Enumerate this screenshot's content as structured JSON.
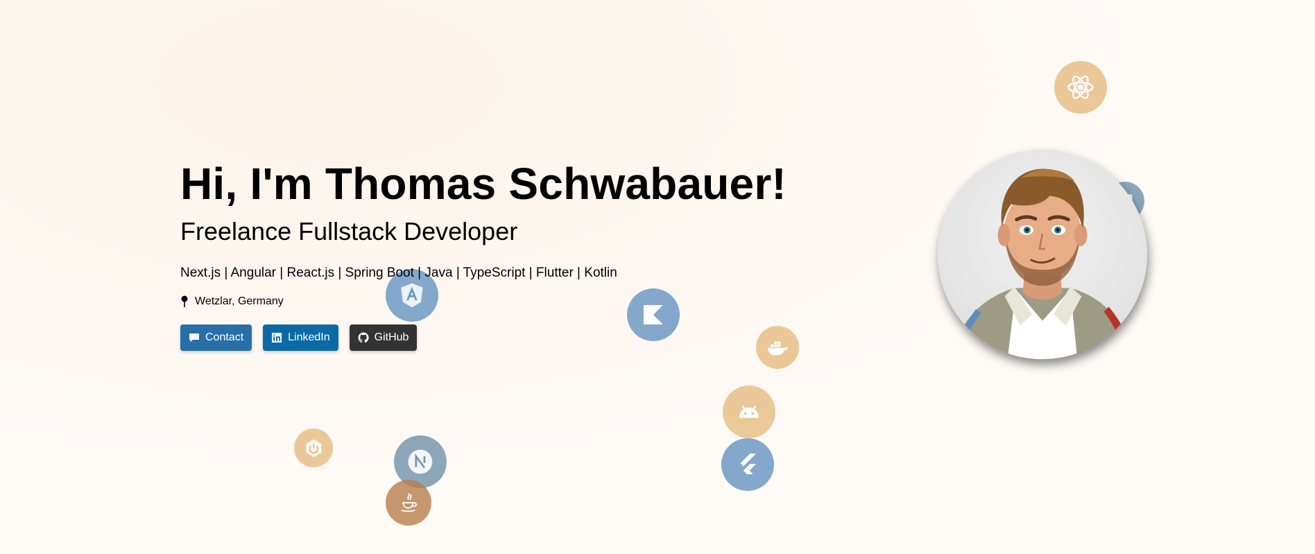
{
  "hero": {
    "title": "Hi, I'm Thomas Schwabauer!",
    "subtitle": "Freelance Fullstack Developer",
    "stack": "Next.js | Angular | React.js | Spring Boot | Java | TypeScript | Flutter | Kotlin",
    "location": "Wetzlar, Germany",
    "location_icon": "pin-icon"
  },
  "buttons": {
    "contact": "Contact",
    "linkedin": "LinkedIn",
    "github": "GitHub"
  },
  "tech_icons": [
    "react-icon",
    "angular-icon",
    "kotlin-icon",
    "docker-icon",
    "android-icon",
    "flutter-icon",
    "spring-icon",
    "nextjs-icon",
    "java-icon",
    "typescript-icon"
  ],
  "colors": {
    "contact": "#266fa8",
    "linkedin": "#0b6aa6",
    "github": "#333333",
    "bubble_blue": "#6896c2",
    "bubble_gold": "#e8c087"
  }
}
